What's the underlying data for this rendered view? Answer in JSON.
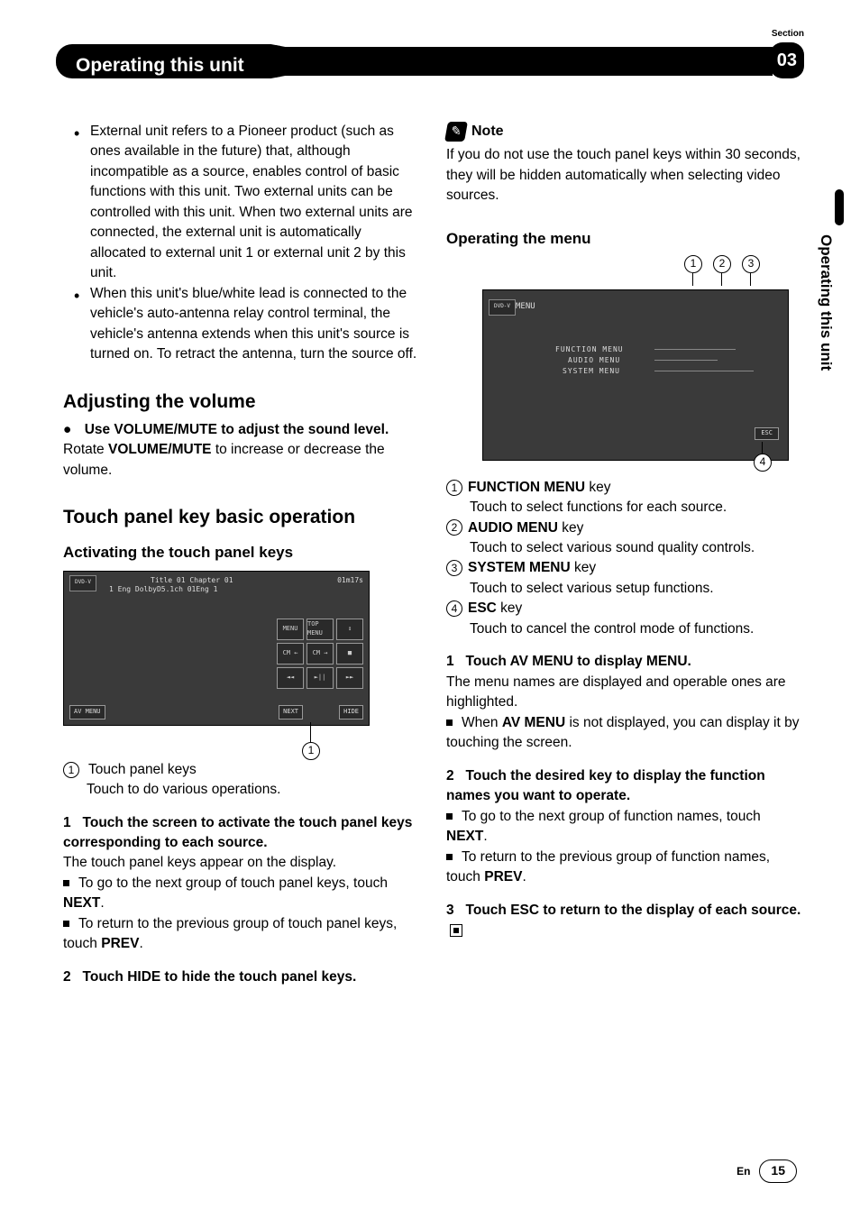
{
  "header": {
    "title": "Operating this unit",
    "section_label": "Section",
    "section_number": "03"
  },
  "sidebar": {
    "text": "Operating this unit"
  },
  "left": {
    "bullets": [
      "External unit refers to a Pioneer product (such as ones available in the future) that, although incompatible as a source, enables control of basic functions with this unit. Two external units can be controlled with this unit. When two external units are connected, the external unit is automatically allocated to external unit 1 or external unit 2 by this unit.",
      "When this unit's blue/white lead is connected to the vehicle's auto-antenna relay control terminal, the vehicle's antenna extends when this unit's source is turned on. To retract the antenna, turn the source off."
    ],
    "adjusting": {
      "heading": "Adjusting the volume",
      "lead_bullet": "●",
      "lead_bold": "Use VOLUME/MUTE to adjust the sound level.",
      "body_pre": "Rotate ",
      "body_bold": "VOLUME/MUTE",
      "body_post": " to increase or decrease the volume."
    },
    "touch": {
      "heading": "Touch panel key basic operation",
      "sub": "Activating the touch panel keys",
      "fig1": {
        "top_left": "Title 01   Chapter 01",
        "top_right": "01m17s",
        "line2": "1   Eng  DolbyD5.1ch  01Eng   1",
        "buttons": [
          "MENU",
          "TOP MENU",
          "↕",
          "CM ←",
          "CM →",
          "■",
          "◄◄",
          "►||",
          "►►"
        ],
        "avmenu": "AV MENU",
        "next": "NEXT",
        "hide": "HIDE",
        "callout": "1"
      },
      "legend_num": "1",
      "legend_label": "Touch panel keys",
      "legend_desc": "Touch to do various operations.",
      "step1_num": "1",
      "step1_bold": "Touch the screen to activate the touch panel keys corresponding to each source.",
      "step1_line": "The touch panel keys appear on the display.",
      "step1_sq1_pre": "To go to the next group of touch panel keys, touch ",
      "step1_sq1_bold": "NEXT",
      "step1_sq2_pre": "To return to the previous group of touch panel keys, touch ",
      "step1_sq2_bold": "PREV",
      "step2_num": "2",
      "step2_bold": "Touch HIDE to hide the touch panel keys."
    }
  },
  "right": {
    "note": {
      "label": "Note",
      "body": "If you do not use the touch panel keys within 30 seconds, they will be hidden automatically when selecting video sources."
    },
    "menu": {
      "heading": "Operating the menu",
      "fig2": {
        "source": "DVD-V",
        "menu_label": "MENU",
        "items": [
          "FUNCTION MENU",
          "AUDIO MENU",
          "SYSTEM MENU"
        ],
        "esc": "ESC",
        "callouts": [
          "1",
          "2",
          "3",
          "4"
        ]
      },
      "legend": [
        {
          "n": "1",
          "bold": "FUNCTION MENU",
          "tail": " key",
          "desc": "Touch to select functions for each source."
        },
        {
          "n": "2",
          "bold": "AUDIO MENU",
          "tail": " key",
          "desc": "Touch to select various sound quality controls."
        },
        {
          "n": "3",
          "bold": "SYSTEM MENU",
          "tail": " key",
          "desc": "Touch to select various setup functions."
        },
        {
          "n": "4",
          "bold": "ESC",
          "tail": " key",
          "desc": "Touch to cancel the control mode of functions."
        }
      ],
      "step1": {
        "num": "1",
        "bold": "Touch AV MENU to display MENU.",
        "line": "The menu names are displayed and operable ones are highlighted.",
        "sq_pre": "When ",
        "sq_bold": "AV MENU",
        "sq_post": " is not displayed, you can display it by touching the screen."
      },
      "step2": {
        "num": "2",
        "bold": "Touch the desired key to display the function names you want to operate.",
        "sq1_pre": "To go to the next group of function names, touch ",
        "sq1_bold": "NEXT",
        "sq2_pre": "To return to the previous group of function names, touch ",
        "sq2_bold": "PREV"
      },
      "step3": {
        "num": "3",
        "bold": "Touch ESC to return to the display of each source."
      }
    }
  },
  "footer": {
    "lang": "En",
    "page": "15"
  }
}
